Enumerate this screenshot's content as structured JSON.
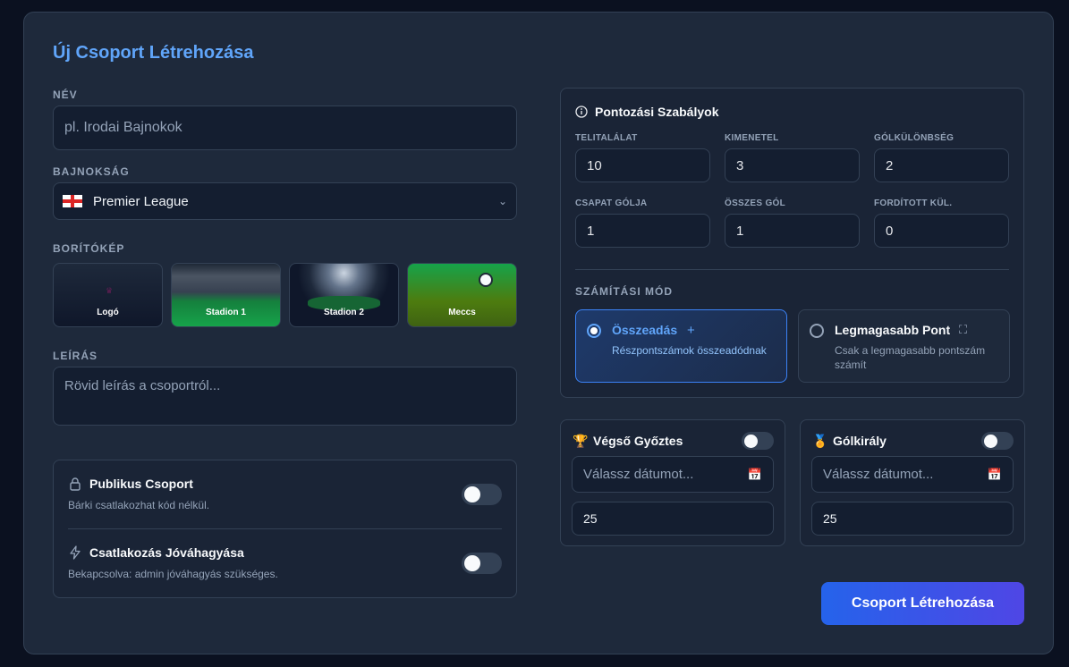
{
  "form": {
    "title": "Új Csoport Létrehozása",
    "name_label": "NÉV",
    "name_placeholder": "pl. Irodai Bajnokok",
    "league_label": "BAJNOKSÁG",
    "league_value": "Premier League",
    "cover_label": "BORÍTÓKÉP",
    "covers": [
      "Logó",
      "Stadion 1",
      "Stadion 2",
      "Meccs"
    ],
    "description_label": "LEÍRÁS",
    "description_placeholder": "Rövid leírás a csoportról...",
    "public_title": "Publikus Csoport",
    "public_sub": "Bárki csatlakozhat kód nélkül.",
    "approval_title": "Csatlakozás Jóváhagyása",
    "approval_sub": "Bekapcsolva: admin jóváhagyás szükséges.",
    "submit_label": "Csoport Létrehozása"
  },
  "rules": {
    "title": "Pontozási Szabályok",
    "fields": [
      {
        "label": "TELITALÁLAT",
        "value": "10"
      },
      {
        "label": "KIMENETEL",
        "value": "3"
      },
      {
        "label": "GÓLKÜLÖNBSÉG",
        "value": "2"
      },
      {
        "label": "CSAPAT GÓLJA",
        "value": "1"
      },
      {
        "label": "ÖSSZES GÓL",
        "value": "1"
      },
      {
        "label": "FORDÍTOTT KÜL.",
        "value": "0"
      }
    ],
    "mode_label": "SZÁMÍTÁSI MÓD",
    "modes": [
      {
        "title": "Összeadás",
        "sub": "Részpontszámok összeadódnak",
        "icon": "plus-icon"
      },
      {
        "title": "Legmagasabb Pont",
        "sub": "Csak a legmagasabb pontszám számít",
        "icon": "expand-icon"
      }
    ]
  },
  "bonus": [
    {
      "title": "Végső Győztes",
      "icon": "trophy-icon",
      "date_placeholder": "Válassz dátumot...",
      "points": "25"
    },
    {
      "title": "Gólkirály",
      "icon": "medal-icon",
      "date_placeholder": "Válassz dátumot...",
      "points": "25"
    }
  ]
}
